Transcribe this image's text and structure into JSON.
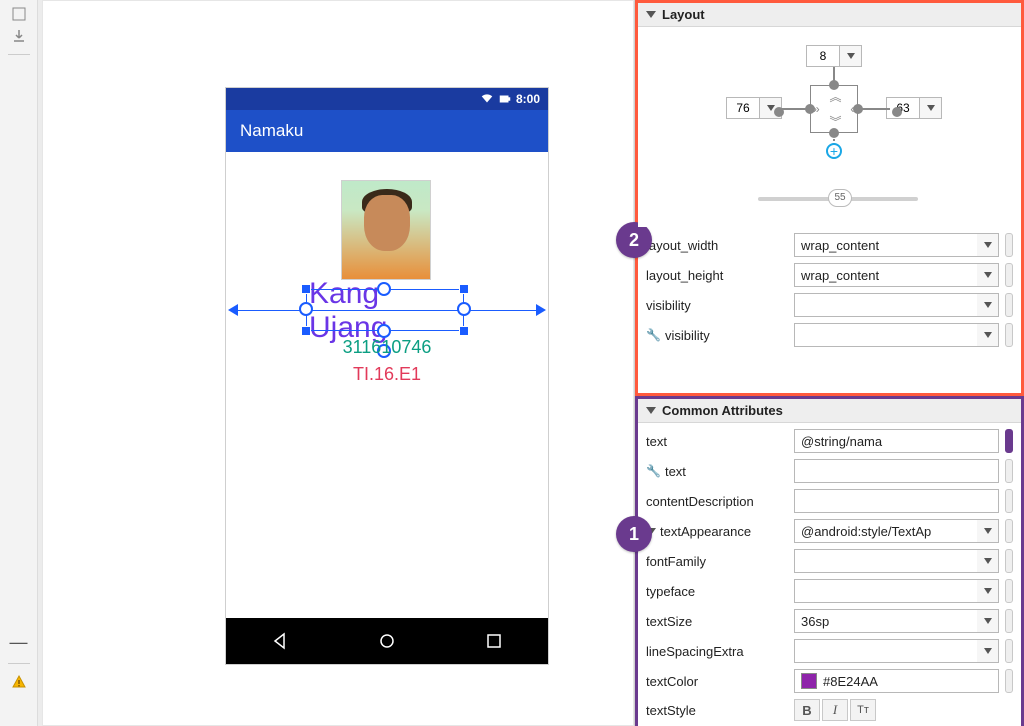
{
  "phone": {
    "time": "8:00",
    "title": "Namaku",
    "name": "Kang Ujang",
    "id": "311610746",
    "class": "TI.16.E1"
  },
  "annotations": {
    "b1": "1",
    "b2": "2"
  },
  "layout_panel": {
    "title": "Layout",
    "margins": {
      "top": "8",
      "left": "76",
      "right": "63"
    },
    "bias": "55",
    "rows": {
      "layout_width": {
        "label": "layout_width",
        "value": "wrap_content"
      },
      "layout_height": {
        "label": "layout_height",
        "value": "wrap_content"
      },
      "visibility": {
        "label": "visibility",
        "value": ""
      },
      "tools_visibility": {
        "label": "visibility",
        "value": ""
      }
    }
  },
  "common_panel": {
    "title": "Common Attributes",
    "rows": {
      "text": {
        "label": "text",
        "value": "@string/nama"
      },
      "tools_text": {
        "label": "text",
        "value": ""
      },
      "contentDescription": {
        "label": "contentDescription",
        "value": ""
      },
      "textAppearance": {
        "label": "textAppearance",
        "placeholder": "@android:style/TextAp"
      },
      "fontFamily": {
        "label": "fontFamily",
        "value": ""
      },
      "typeface": {
        "label": "typeface",
        "value": ""
      },
      "textSize": {
        "label": "textSize",
        "value": "36sp"
      },
      "lineSpacingExtra": {
        "label": "lineSpacingExtra",
        "value": ""
      },
      "textColor": {
        "label": "textColor",
        "value": "#8E24AA"
      },
      "textStyle": {
        "label": "textStyle"
      }
    }
  }
}
